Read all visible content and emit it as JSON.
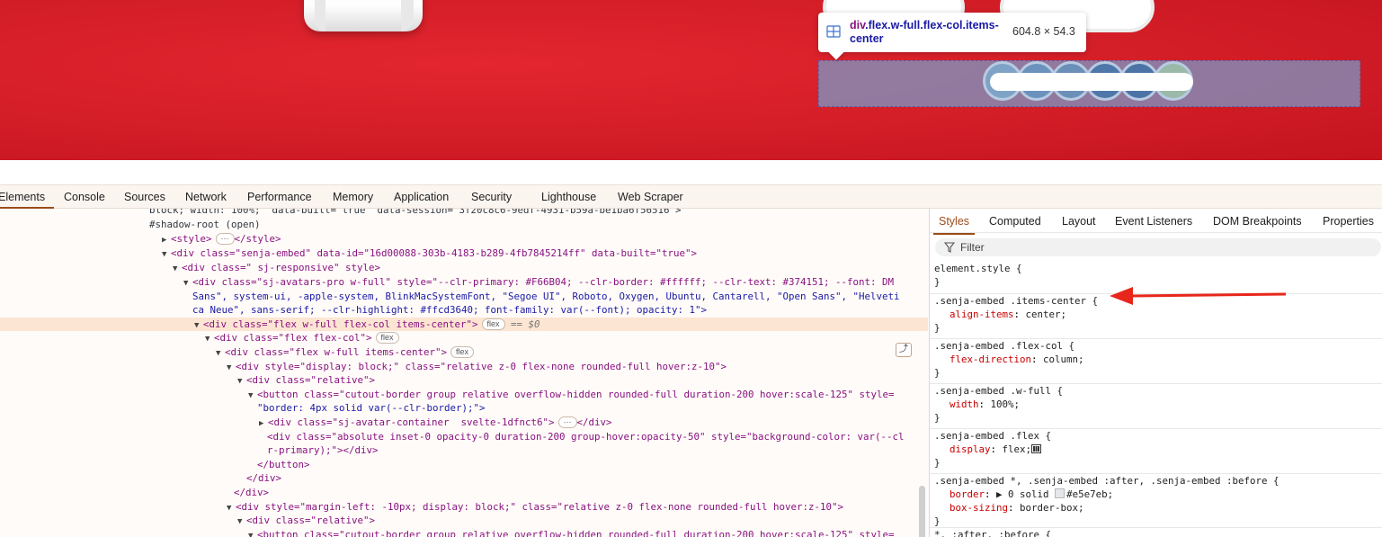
{
  "inspector_tooltip": {
    "tag": "div",
    "classes": ".flex.w-full.flex-col.items-center",
    "size": "604.8 × 54.3",
    "icon": "grid-layout-icon"
  },
  "devtools_tabs": [
    "Elements",
    "Console",
    "Sources",
    "Network",
    "Performance",
    "Memory",
    "Application",
    "Security",
    "Lighthouse",
    "Web Scraper"
  ],
  "active_tab": "Elements",
  "elements_lines": {
    "l0": "block; width: 100%;\" data-built=\"true\" data-session=\"3f20c8c6-9edf-4931-b59a-be1ba6f56516\">",
    "l1": "#shadow-root (open)",
    "l2_tag_open": "<style>",
    "l2_tag_close": "</style>",
    "l3": "<div class=\"senja-embed\" data-id=\"16d00088-303b-4183-b289-4fb7845214ff\" data-built=\"true\">",
    "l4": "<div class=\" sj-responsive\" style>",
    "l5": "<div class=\"sj-avatars-pro w-full\" style=\"--clr-primary: #F66B04; --clr-border: #ffffff; --clr-text: #374151; --font: DM",
    "l6": "Sans\", system-ui, -apple-system, BlinkMacSystemFont, \"Segoe UI\", Roboto, Oxygen, Ubuntu, Cantarell, \"Open Sans\", \"Helveti",
    "l7": "ca Neue\", sans-serif; --clr-highlight: #ffcd3640; font-family: var(--font); opacity: 1\">",
    "l8": "<div class=\"flex w-full flex-col items-center\">",
    "l8_suffix": "== $0",
    "l9": "<div class=\"flex flex-col\">",
    "l10": "<div class=\"flex w-full items-center\">",
    "l11": "<div style=\"display: block;\" class=\"relative z-0 flex-none rounded-full hover:z-10\">",
    "l12": "<div class=\"relative\">",
    "l13": "<button class=\"cutout-border group relative overflow-hidden rounded-full duration-200 hover:scale-125\" style=",
    "l14": "\"border: 4px solid var(--clr-border);\">",
    "l15_open": "<div class=\"sj-avatar-container  svelte-1dfnct6\">",
    "l15_close": "</div>",
    "l16": "<div class=\"absolute inset-0 opacity-0 duration-200 group-hover:opacity-50\" style=\"background-color: var(--cl",
    "l17": "r-primary);\"></div>",
    "l18": "</button>",
    "l19": "</div>",
    "l20": "</div>",
    "l21": "<div style=\"margin-left: -10px; display: block;\" class=\"relative z-0 flex-none rounded-full hover:z-10\">",
    "l22": "<div class=\"relative\">",
    "l23": "<button class=\"cutout-border group relative overflow-hidden rounded-full duration-200 hover:scale-125\" style=",
    "badge_flex": "flex",
    "ellipsis": "···"
  },
  "styles_tabs": [
    "Styles",
    "Computed",
    "Layout",
    "Event Listeners",
    "DOM Breakpoints",
    "Properties"
  ],
  "active_styles_tab": "Styles",
  "filter_placeholder": "Filter",
  "css_rules": {
    "r0_selector": "element.style {",
    "r1_selector": ".senja-embed .items-center {",
    "r1_prop": "align-items",
    "r1_val": "center;",
    "r2_selector": ".senja-embed .flex-col {",
    "r2_prop": "flex-direction",
    "r2_val": "column;",
    "r3_selector": ".senja-embed .w-full {",
    "r3_prop": "width",
    "r3_val": "100%;",
    "r4_selector": ".senja-embed .flex {",
    "r4_prop": "display",
    "r4_val": "flex;",
    "r5_selector": ".senja-embed *, .senja-embed :after, .senja-embed :before {",
    "r5_prop1": "border",
    "r5_val1": "▶ 0 solid",
    "r5_color": "#e5e7eb;",
    "r5_prop2": "box-sizing",
    "r5_val2": "border-box;",
    "r6_selector": "*, :after, :before {",
    "close_brace": "}"
  },
  "colors": {
    "brand_red": "#d31d27",
    "highlight_overlay": "#6fa8dc",
    "devtools_accent": "#9b4c19",
    "annotation_arrow": "#e8261b"
  }
}
